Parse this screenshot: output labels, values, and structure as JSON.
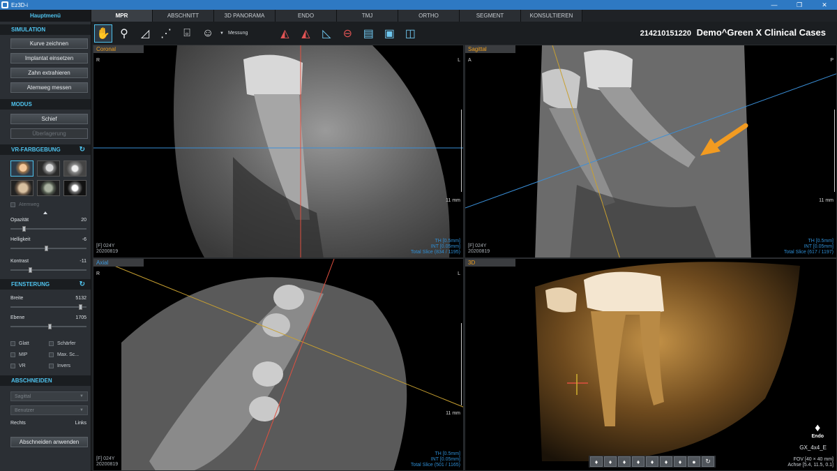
{
  "window": {
    "title": "Ez3D-i",
    "controls": [
      "—",
      "❐",
      "✕"
    ]
  },
  "left_panel": {
    "main_menu": "Hauptmenü",
    "simulation": {
      "header": "SIMULATION",
      "buttons": [
        "Kurve zeichnen",
        "Implantat einsetzen",
        "Zahn extrahieren",
        "Atemweg messen"
      ]
    },
    "modus": {
      "header": "MODUS",
      "schief": "Schief",
      "ueberlagerung": "Überlagerung"
    },
    "vr": {
      "header": "VR-FARBGEBUNG",
      "atemweg": "Atemweg",
      "opazitaet_label": "Opazität",
      "opazitaet_value": "20",
      "opazitaet_level": 0.18,
      "helligkeit_label": "Helligkeit",
      "helligkeit_value": "-6",
      "helligkeit_level": 0.48,
      "kontrast_label": "Kontrast",
      "kontrast_value": "-11",
      "kontrast_level": 0.27
    },
    "fensterung": {
      "header": "FENSTERUNG",
      "breite_label": "Breite",
      "breite_value": "5132",
      "breite_level": 0.93,
      "ebene_label": "Ebene",
      "ebene_value": "1705",
      "ebene_level": 0.52,
      "glatt": "Glatt",
      "schaerfer": "Schärfer",
      "mip": "MIP",
      "max_sc": "Max. Sc...",
      "vr": "VR",
      "invers": "Invers"
    },
    "abschneiden": {
      "header": "ABSCHNEIDEN",
      "dropdown1": "Sagittal",
      "dropdown2": "Benutzer",
      "rechts": "Rechts",
      "links": "Links",
      "apply": "Abschneiden anwenden"
    }
  },
  "tabs": [
    "MPR",
    "ABSCHNITT",
    "3D PANORAMA",
    "ENDO",
    "TMJ",
    "ORTHO",
    "SEGMENT",
    "KONSULTIEREN"
  ],
  "toolbar": {
    "messung": "Messung",
    "patient_id": "214210151220",
    "patient_name": "Demo^Green X Clinical Cases"
  },
  "viewports": {
    "coronal": {
      "title": "Coronal",
      "left": "R",
      "right": "L",
      "scale": "11 mm",
      "age": "[F] 024Y",
      "date": "20200819",
      "th": "TH [0.5mm]",
      "int": "INT [0.05mm]",
      "slice": "Total Slice (834 / 1195)"
    },
    "sagittal": {
      "title": "Sagittal",
      "left": "A",
      "right": "P",
      "scale": "11 mm",
      "age": "[F] 024Y",
      "date": "20200819",
      "th": "TH [0.5mm]",
      "int": "INT [0.05mm]",
      "slice": "Total Slice (617 / 1197)"
    },
    "axial": {
      "title": "Axial",
      "left": "R",
      "right": "L",
      "scale": "11 mm",
      "age": "[F] 024Y",
      "date": "20200819",
      "th": "TH [0.5mm]",
      "int": "INT [0.05mm]",
      "slice": "Total Slice (501 / 1165)"
    },
    "three_d": {
      "title": "3D",
      "endo_label": "Endo",
      "preset": "GX_4x4_E",
      "fov": "FOV [40 × 40 mm]",
      "achse": "Achse [5.4, 11.5, 0.1]"
    }
  },
  "colors": {
    "accent": "#4fc3ee",
    "title_orange": "#f0a020",
    "title_blue": "#3d9be0",
    "crosshair_red": "#e05040",
    "crosshair_blue": "#3a8fd8",
    "crosshair_yellow": "#c8a030",
    "arrow": "#f29b21"
  }
}
